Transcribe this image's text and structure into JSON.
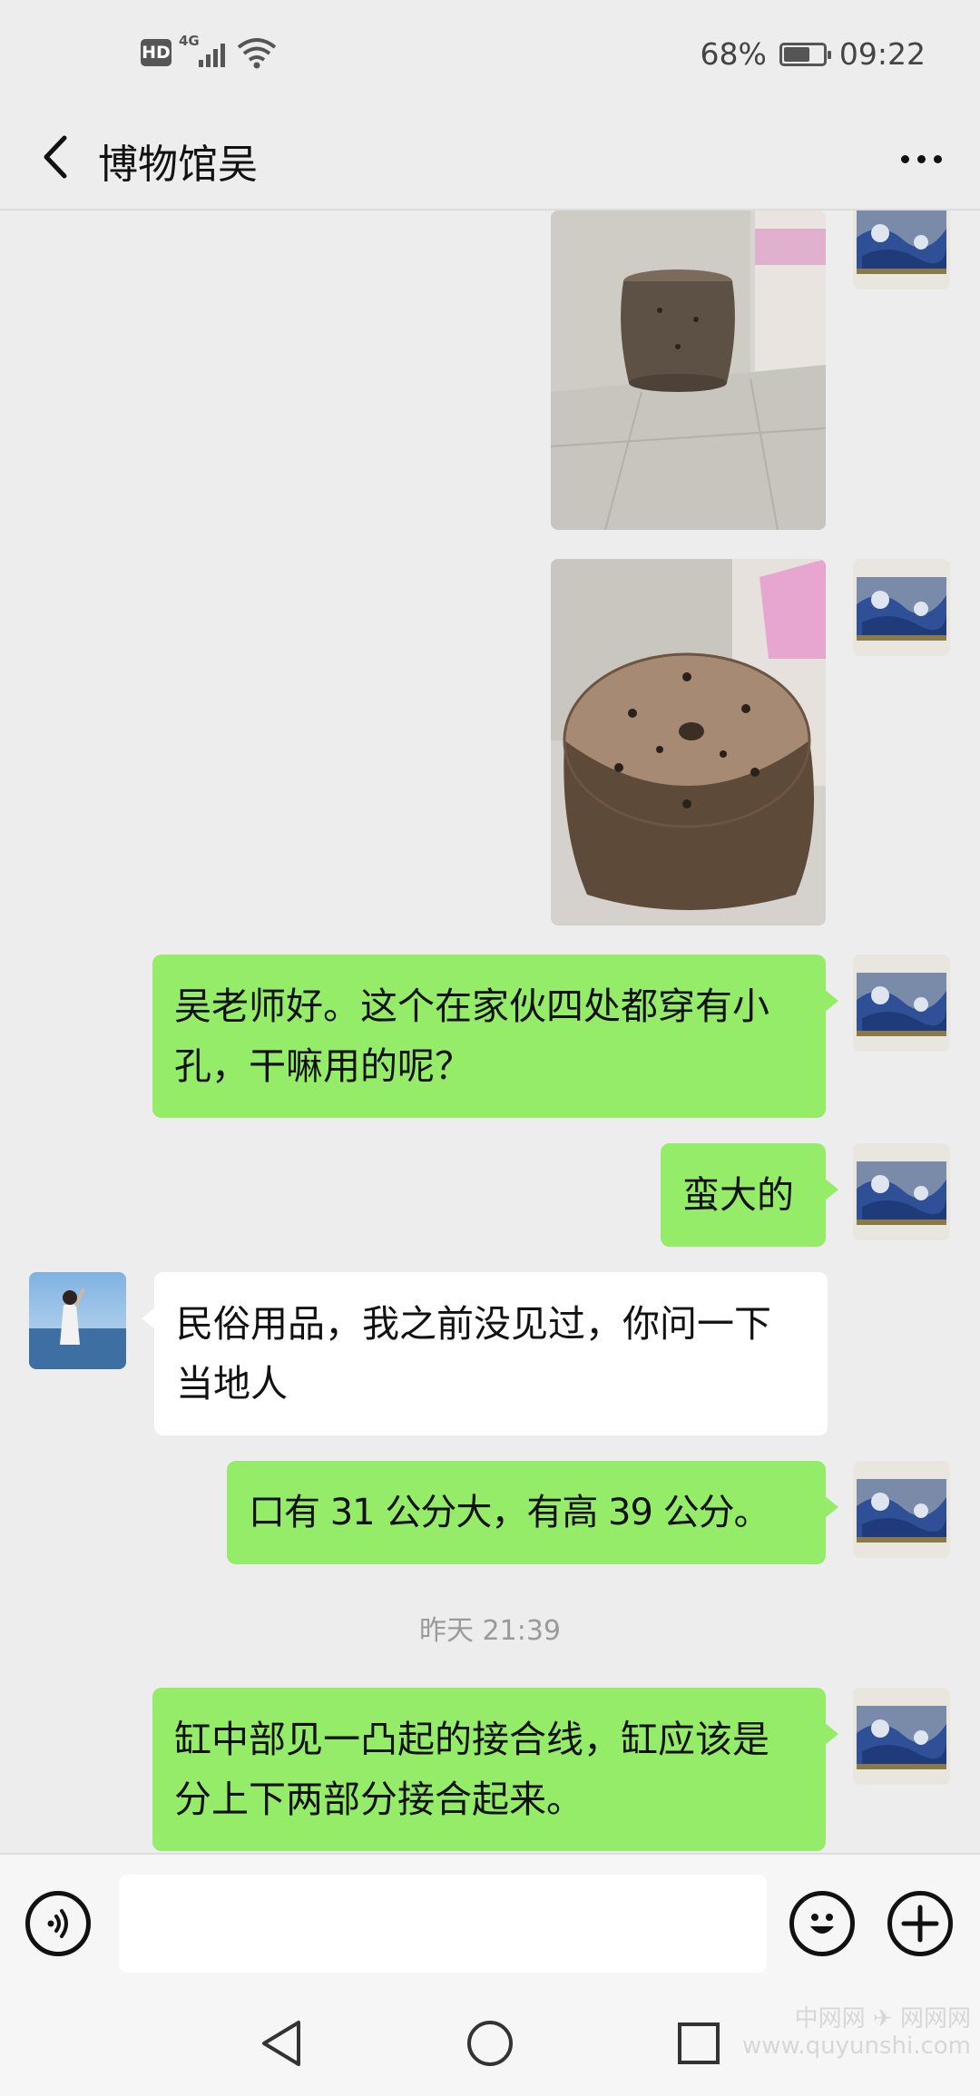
{
  "status_bar": {
    "hd": "HD",
    "network": "4G",
    "battery_percent_text": "68%",
    "battery_level": 0.68,
    "time": "09:22"
  },
  "header": {
    "title": "博物馆吴",
    "back_icon": "chevron-left-icon",
    "more_icon": "more-dots-icon"
  },
  "messages": [
    {
      "sender": "me",
      "type": "image",
      "subject": "pottery jar in corner"
    },
    {
      "sender": "me",
      "type": "image",
      "subject": "pottery jar top with holes"
    },
    {
      "sender": "me",
      "type": "text",
      "text": "吴老师好。这个在家伙四处都穿有小孔，干嘛用的呢？"
    },
    {
      "sender": "me",
      "type": "text",
      "text": "蛮大的"
    },
    {
      "sender": "other",
      "type": "text",
      "text": "民俗用品，我之前没见过，你问一下当地人"
    },
    {
      "sender": "me",
      "type": "text",
      "text": "口有 31 公分大，有高 39 公分。"
    },
    {
      "type": "time",
      "text": "昨天 21:39"
    },
    {
      "sender": "me",
      "type": "text",
      "text": "缸中部见一凸起的接合线，缸应该是分上下两部分接合起来。"
    }
  ],
  "input_bar": {
    "voice_icon": "voice-icon",
    "emoji_icon": "emoji-icon",
    "plus_icon": "plus-icon",
    "value": ""
  },
  "nav_bar": {
    "back_icon": "triangle-back-icon",
    "home_icon": "circle-home-icon",
    "recents_icon": "square-recents-icon"
  },
  "watermark": {
    "line1": "中网网 ✈ 网网网",
    "line2": "www.quyunshi.com"
  },
  "colors": {
    "background": "#ededed",
    "bubble_me": "#95ec69",
    "bubble_other": "#ffffff",
    "time_text": "#9a9a9a"
  }
}
